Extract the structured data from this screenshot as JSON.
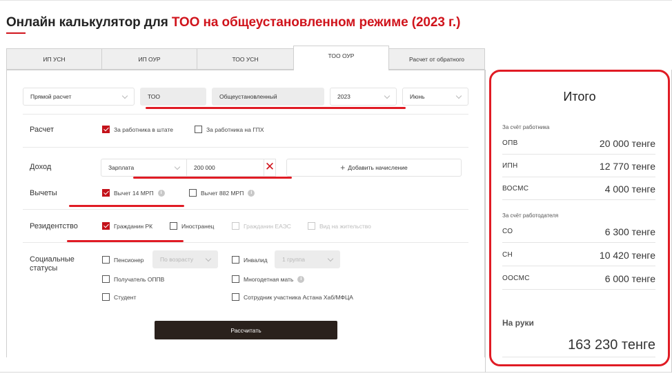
{
  "page": {
    "title_prefix": "Онлайн калькулятор для ",
    "title_accent": "ТОО на общеустановленном режиме (2023 г.)",
    "accent_color": "#d0141c"
  },
  "tabs": [
    {
      "label": "ИП УСН",
      "active": false
    },
    {
      "label": "ИП ОУР",
      "active": false
    },
    {
      "label": "ТОО УСН",
      "active": false
    },
    {
      "label": "ТОО ОУР",
      "active": true
    },
    {
      "label": "Расчет от обратного",
      "active": false
    }
  ],
  "filters": {
    "calc_type": "Прямой расчет",
    "entity": "ТОО",
    "regime": "Общеустановленный",
    "year": "2023",
    "month": "Июнь"
  },
  "calc": {
    "label": "Расчет",
    "options": [
      {
        "label": "За работника в штате",
        "checked": true
      },
      {
        "label": "За работника на ГПХ",
        "checked": false
      }
    ]
  },
  "income": {
    "label": "Доход",
    "type": "Зарплата",
    "amount": "200 000",
    "clear_icon": "✕",
    "add_label": "Добавить начисление",
    "add_icon": "+"
  },
  "deductions": {
    "label": "Вычеты",
    "options": [
      {
        "label": "Вычет 14 МРП",
        "checked": true
      },
      {
        "label": "Вычет 882 МРП",
        "checked": false
      }
    ]
  },
  "residency": {
    "label": "Резидентство",
    "options": [
      {
        "label": "Гражданин РК",
        "checked": true,
        "disabled": false
      },
      {
        "label": "Иностранец",
        "checked": false,
        "disabled": false
      },
      {
        "label": "Гражданин ЕАЭС",
        "checked": false,
        "disabled": true
      },
      {
        "label": "Вид на жительство",
        "checked": false,
        "disabled": true
      }
    ]
  },
  "social": {
    "label": "Социальные статусы",
    "pensioner": {
      "label": "Пенсионер",
      "checked": false,
      "select": "По возрасту"
    },
    "disabled_person": {
      "label": "Инвалид",
      "checked": false,
      "select": "1 группа"
    },
    "oppv": {
      "label": "Получатель ОППВ",
      "checked": false
    },
    "mother": {
      "label": "Многодетная мать",
      "checked": false
    },
    "student": {
      "label": "Студент",
      "checked": false
    },
    "astana": {
      "label": "Сотрудник участника Астана Хаб/МФЦА",
      "checked": false
    }
  },
  "calculate_label": "Рассчитать",
  "result": {
    "title": "Итого",
    "employee_section": "За счёт работника",
    "employee": [
      {
        "key": "ОПВ",
        "value": "20 000 тенге"
      },
      {
        "key": "ИПН",
        "value": "12 770 тенге"
      },
      {
        "key": "ВОСМС",
        "value": "4 000 тенге"
      }
    ],
    "employer_section": "За счёт работодателя",
    "employer": [
      {
        "key": "СО",
        "value": "6 300 тенге"
      },
      {
        "key": "СН",
        "value": "10 420 тенге"
      },
      {
        "key": "ООСМС",
        "value": "6 000 тенге"
      }
    ],
    "net_label": "На руки",
    "net_value": "163 230 тенге"
  }
}
